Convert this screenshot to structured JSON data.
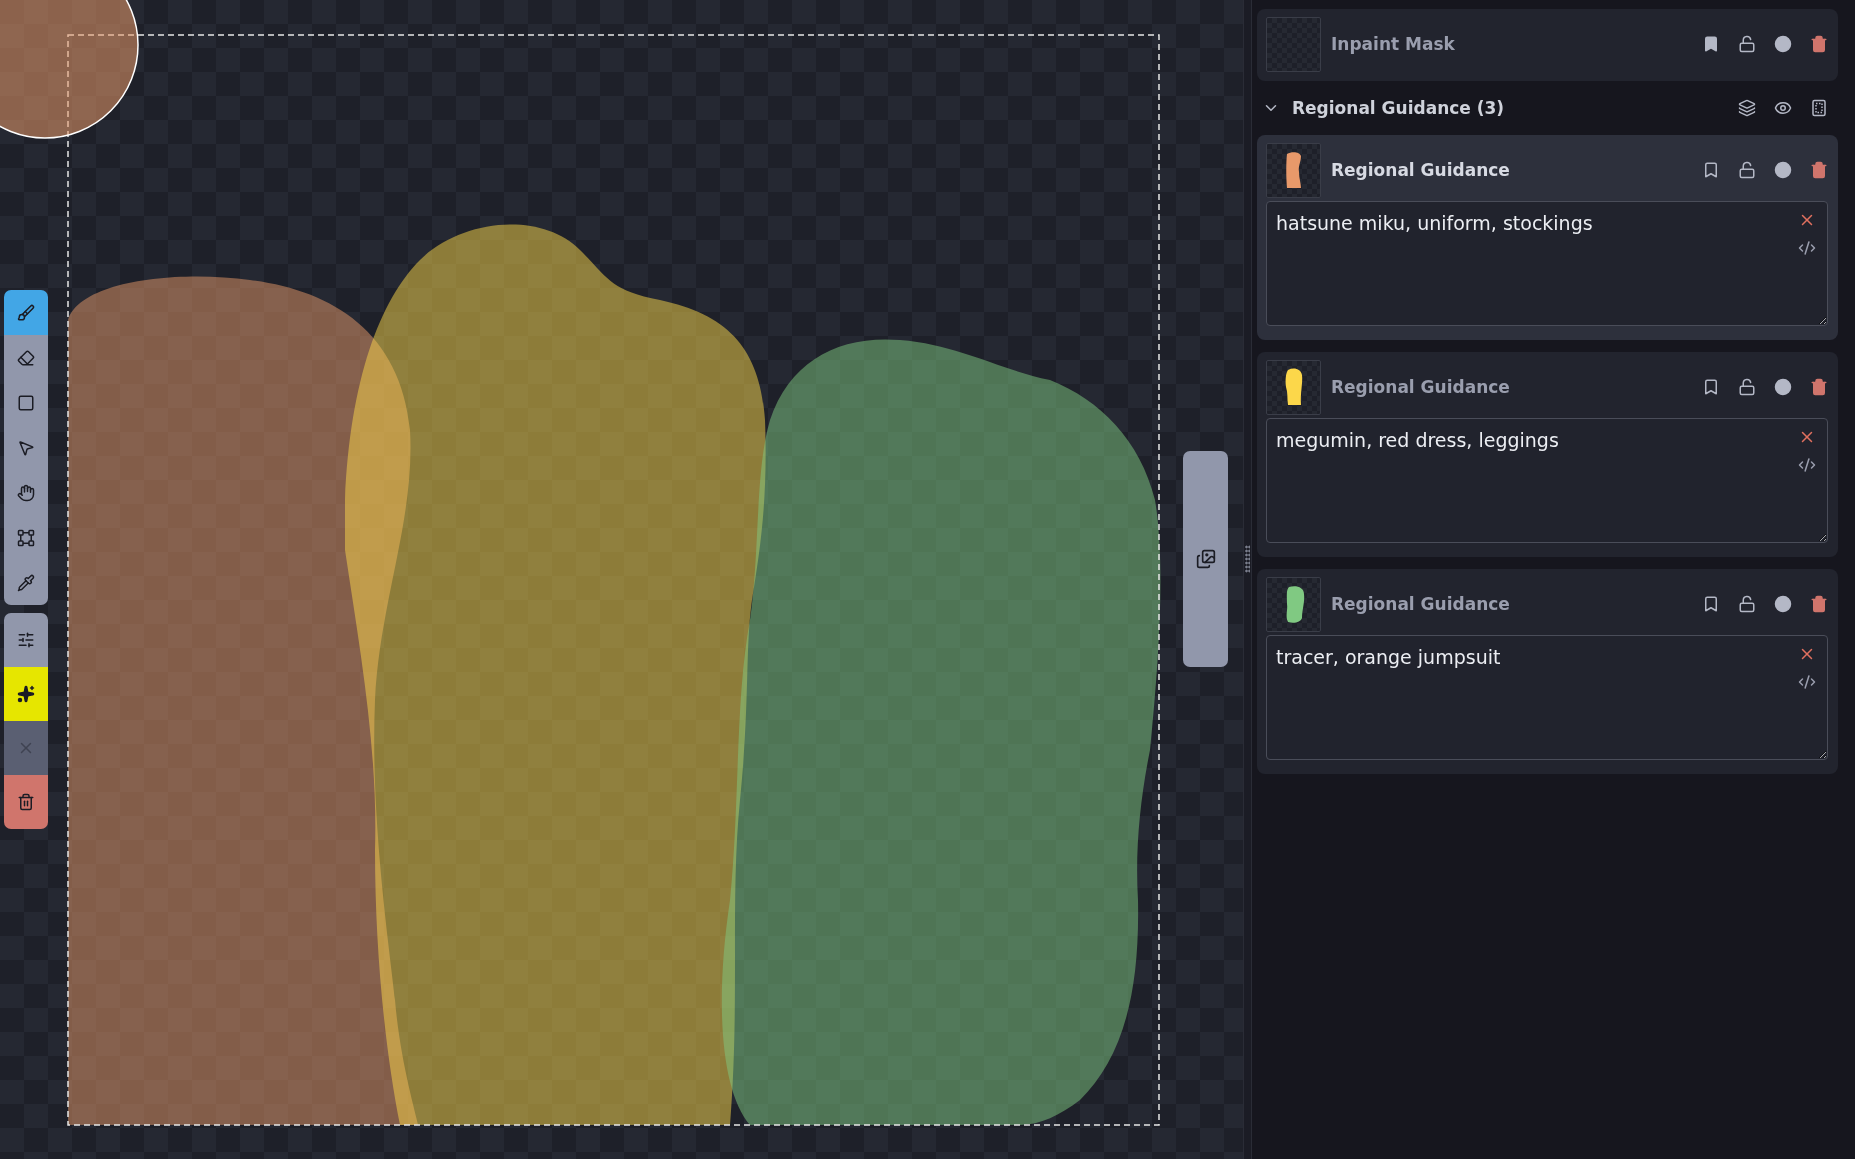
{
  "toolbar": {
    "tools": [
      {
        "kind": "brush",
        "selected": true
      },
      {
        "kind": "eraser",
        "selected": false
      },
      {
        "kind": "rectangle",
        "selected": false
      },
      {
        "kind": "move",
        "selected": false
      },
      {
        "kind": "view",
        "selected": false
      },
      {
        "kind": "transform",
        "selected": false
      },
      {
        "kind": "colorpicker",
        "selected": false
      }
    ],
    "actions": [
      {
        "kind": "settings",
        "disabled": false
      },
      {
        "kind": "sparkle",
        "disabled": false
      },
      {
        "kind": "cancel",
        "disabled": true
      },
      {
        "kind": "delete",
        "disabled": false
      }
    ]
  },
  "inpaint_mask": {
    "title": "Inpaint Mask",
    "selected": false,
    "bookmarked": true,
    "locked": false,
    "enabled": true
  },
  "regional_guidance": {
    "title": "Regional Guidance (3)",
    "expanded": true,
    "layers": [
      {
        "title": "Regional Guidance",
        "selected": true,
        "bookmarked": false,
        "locked": false,
        "enabled": true,
        "color": "#e8996a",
        "prompt": "hatsune miku, uniform, stockings"
      },
      {
        "title": "Regional Guidance",
        "selected": false,
        "bookmarked": false,
        "locked": false,
        "enabled": true,
        "color": "#fcd74a",
        "prompt": "megumin, red dress, leggings"
      },
      {
        "title": "Regional Guidance",
        "selected": false,
        "bookmarked": false,
        "locked": false,
        "enabled": true,
        "color": "#80c982",
        "prompt": "tracer, orange jumpsuit"
      }
    ]
  }
}
